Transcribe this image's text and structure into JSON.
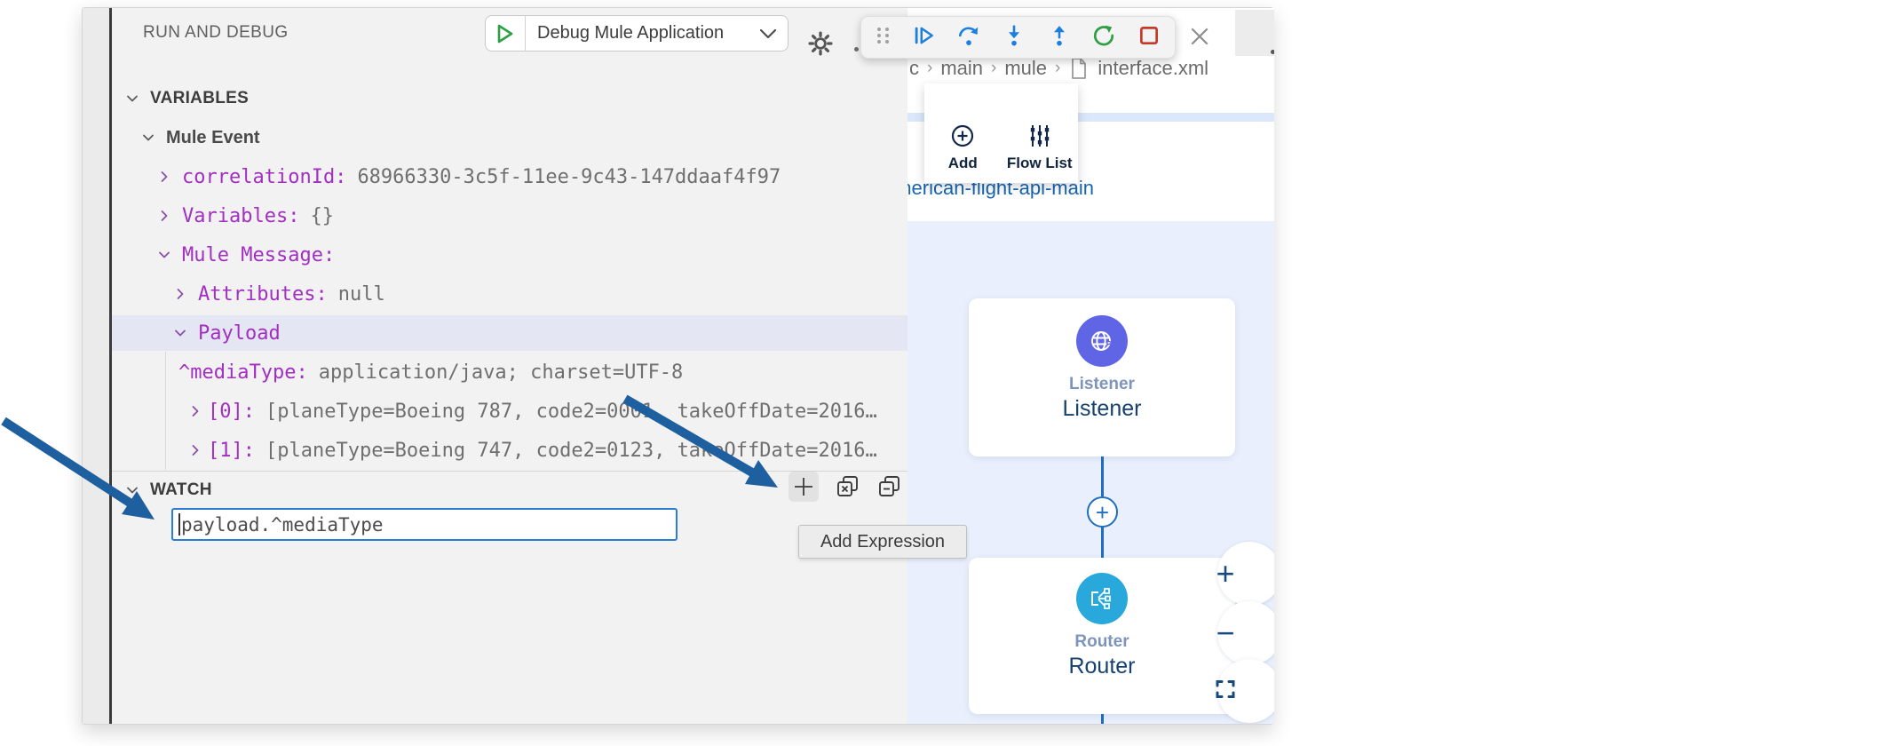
{
  "sidebar": {
    "title": "RUN AND DEBUG",
    "launch_config": {
      "label": "Debug Mule Application"
    },
    "variables": {
      "title": "VARIABLES",
      "rows": [
        {
          "key": "Mule Event",
          "value": ""
        },
        {
          "key": "correlationId:",
          "value": "68966330-3c5f-11ee-9c43-147ddaaf4f97"
        },
        {
          "key": "Variables:",
          "value": "{}"
        },
        {
          "key": "Mule Message:",
          "value": ""
        },
        {
          "key": "Attributes:",
          "value": "null"
        },
        {
          "key": "Payload",
          "value": ""
        },
        {
          "key": "^mediaType:",
          "value": "application/java; charset=UTF-8"
        },
        {
          "key": "[0]:",
          "value": "[planeType=Boeing 787, code2=0001, takeOffDate=2016…"
        },
        {
          "key": "[1]:",
          "value": "[planeType=Boeing 747, code2=0123, takeOffDate=2016…"
        }
      ]
    },
    "watch": {
      "title": "WATCH",
      "expression": "payload.^mediaType",
      "tooltip": "Add Expression",
      "icons": [
        "add-expression",
        "remove-all-expressions",
        "collapse-all"
      ]
    }
  },
  "debug_toolbar": {
    "icons": [
      "drag-handle",
      "continue",
      "step-over",
      "step-into",
      "step-out",
      "restart",
      "stop"
    ],
    "close": "close"
  },
  "editor": {
    "breadcrumb": {
      "items": [
        "c",
        "main",
        "mule"
      ],
      "file": "interface.xml"
    },
    "flow_title": "american-flight-api-main",
    "palette_popup": {
      "buttons": [
        {
          "label": "Add"
        },
        {
          "label": "Flow List"
        }
      ]
    },
    "canvas": {
      "nodes": [
        {
          "type": "Listener",
          "name": "Listener",
          "icon": "globe-icon",
          "color": "#6065e6"
        },
        {
          "type": "Router",
          "name": "Router",
          "icon": "router-icon",
          "color": "#29a8dc"
        }
      ],
      "zoom_controls": [
        "zoom-in",
        "zoom-out",
        "fit-screen"
      ],
      "plus_glyph": "+",
      "minus_glyph": "−",
      "connector_plus": "+"
    }
  },
  "colors": {
    "accent_blue": "#1b7fe0",
    "restart_green": "#2f9e44",
    "stop_red": "#c13a2a",
    "play_green": "#2da044",
    "key_purple": "#a22fc2",
    "canvas_bg": "#e9effc",
    "annotation_arrow": "#1d5f9f",
    "selection_lavender": "#e4e6f3"
  }
}
